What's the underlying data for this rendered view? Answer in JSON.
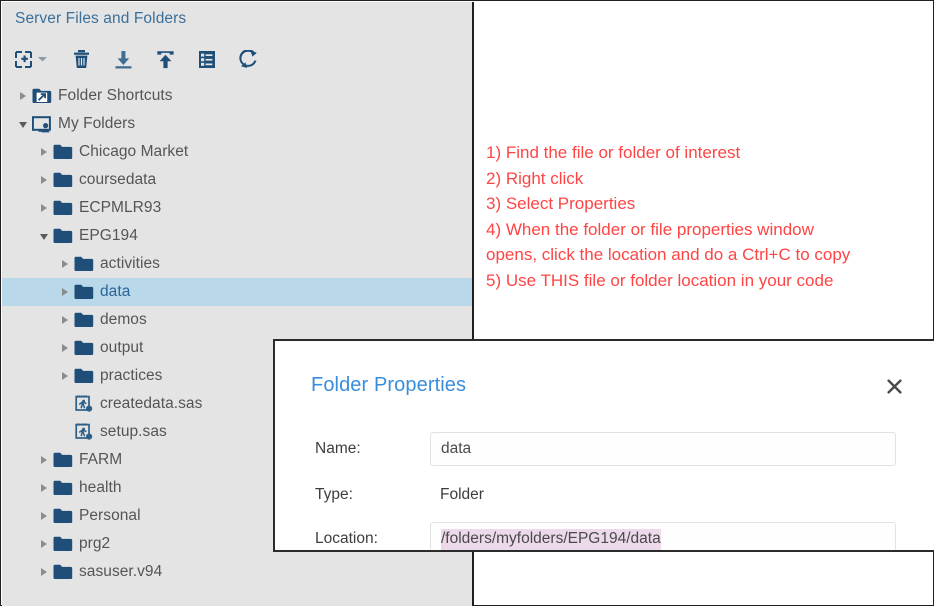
{
  "panel": {
    "title": "Server Files and Folders",
    "toolbar": [
      {
        "name": "new-icon",
        "label": "New",
        "glyph": "new"
      },
      {
        "name": "delete-icon",
        "label": "Delete",
        "glyph": "trash"
      },
      {
        "name": "download-icon",
        "label": "Download Files",
        "glyph": "download"
      },
      {
        "name": "upload-icon",
        "label": "Upload Files",
        "glyph": "upload"
      },
      {
        "name": "properties-icon",
        "label": "Properties",
        "glyph": "properties"
      },
      {
        "name": "refresh-icon",
        "label": "Refresh",
        "glyph": "refresh"
      }
    ],
    "tree": [
      {
        "label": "Folder Shortcuts",
        "icon": "shortcut-folder-icon",
        "state": "collapsed",
        "depth": 0,
        "selected": false
      },
      {
        "label": "My Folders",
        "icon": "my-folders-icon",
        "state": "expanded",
        "depth": 0,
        "selected": false
      },
      {
        "label": "Chicago Market",
        "icon": "folder-icon",
        "state": "collapsed",
        "depth": 1,
        "selected": false
      },
      {
        "label": "coursedata",
        "icon": "folder-icon",
        "state": "collapsed",
        "depth": 1,
        "selected": false
      },
      {
        "label": "ECPMLR93",
        "icon": "folder-icon",
        "state": "collapsed",
        "depth": 1,
        "selected": false
      },
      {
        "label": "EPG194",
        "icon": "folder-icon",
        "state": "expanded",
        "depth": 1,
        "selected": false
      },
      {
        "label": "activities",
        "icon": "folder-icon",
        "state": "collapsed",
        "depth": 2,
        "selected": false
      },
      {
        "label": "data",
        "icon": "folder-icon",
        "state": "collapsed",
        "depth": 2,
        "selected": true
      },
      {
        "label": "demos",
        "icon": "folder-icon",
        "state": "collapsed",
        "depth": 2,
        "selected": false
      },
      {
        "label": "output",
        "icon": "folder-icon",
        "state": "collapsed",
        "depth": 2,
        "selected": false
      },
      {
        "label": "practices",
        "icon": "folder-icon",
        "state": "collapsed",
        "depth": 2,
        "selected": false
      },
      {
        "label": "createdata.sas",
        "icon": "sas-program-icon",
        "state": "leaf",
        "depth": 2,
        "selected": false
      },
      {
        "label": "setup.sas",
        "icon": "sas-program-icon",
        "state": "leaf",
        "depth": 2,
        "selected": false
      },
      {
        "label": "FARM",
        "icon": "folder-icon",
        "state": "collapsed",
        "depth": 1,
        "selected": false
      },
      {
        "label": "health",
        "icon": "folder-icon",
        "state": "collapsed",
        "depth": 1,
        "selected": false
      },
      {
        "label": "Personal",
        "icon": "folder-icon",
        "state": "collapsed",
        "depth": 1,
        "selected": false
      },
      {
        "label": "prg2",
        "icon": "folder-icon",
        "state": "collapsed",
        "depth": 1,
        "selected": false
      },
      {
        "label": "sasuser.v94",
        "icon": "folder-icon",
        "state": "collapsed",
        "depth": 1,
        "selected": false
      }
    ]
  },
  "annotation": {
    "color": "#ff4444",
    "lines": [
      "1) Find the file or folder of interest",
      "2) Right click",
      "3) Select Properties",
      "4) When the folder or file properties window",
      "opens, click the location and do a Ctrl+C to copy",
      "5) Use THIS file or folder location in your code"
    ]
  },
  "dialog": {
    "title": "Folder Properties",
    "close_label": "✕",
    "fields": {
      "name_label": "Name:",
      "name_value": "data",
      "type_label": "Type:",
      "type_value": "Folder",
      "location_label": "Location:",
      "location_value": "/folders/myfolders/EPG194/data"
    }
  },
  "colors": {
    "panel_bg": "#e4e4e4",
    "panel_title": "#3a6f9a",
    "folder_blue": "#1f4f78",
    "selection_row": "#b9d9ea",
    "selected_text": "#2a6496",
    "annotation_red": "#ff4444",
    "dialog_title_blue": "#3a8ddc",
    "text_selection_highlight": "#ecd9ec"
  }
}
